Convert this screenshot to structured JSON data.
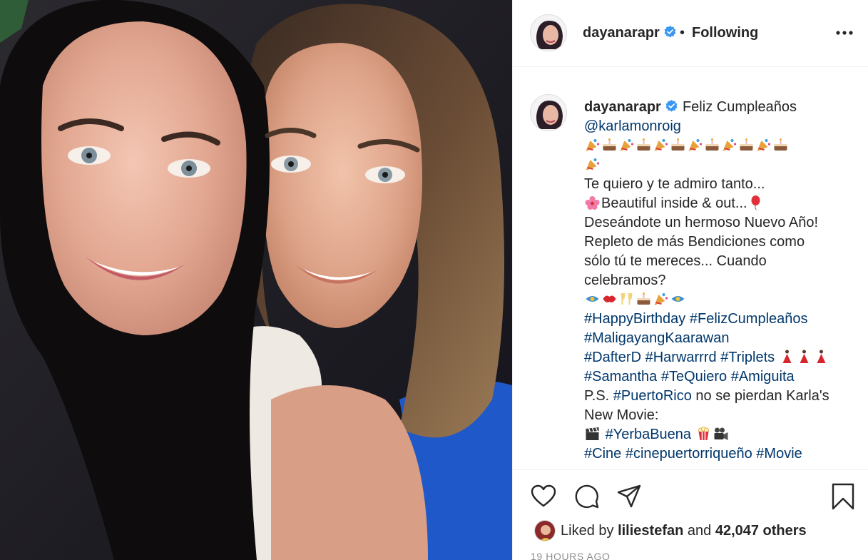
{
  "post": {
    "username": "dayanarapr",
    "dot": "•",
    "follow_status": "Following",
    "more_icon": "more-horizontal-icon",
    "verified_icon": "verified-badge-icon",
    "caption": {
      "greeting": "Feliz Cumpleaños",
      "mention": "@karlamonroig",
      "line_admire": "Te quiero y te admiro tanto...",
      "line_beautiful": "Beautiful inside & out...",
      "line_new_year": "Deseándote un hermoso Nuevo Año!",
      "line_blessings": "Repleto de más Bendiciones como",
      "line_deserve": "sólo tú te mereces... Cuando",
      "line_celebrate": "celebramos?",
      "tag_happybirthday": "#HappyBirthday",
      "tag_felizcumple": "#FelizCumpleaños",
      "tag_maligayang": "#MaligayangKaarawan",
      "tag_dafterd": "#DafterD",
      "tag_harwarrrd": "#Harwarrrd",
      "tag_triplets": "#Triplets",
      "tag_samantha": "#Samantha",
      "tag_tequiero": "#TeQuiero",
      "tag_amiguita": "#Amiguita",
      "ps_prefix": "P.S.",
      "tag_puertorico": "#PuertoRico",
      "ps_rest": "no se pierdan Karla's",
      "line_movie": "New Movie:",
      "tag_yerbabuena": "#YerbaBuena",
      "tag_cine": "#Cine",
      "tag_cinepr": "#cinepuertorriqueño",
      "tag_movie": "#Movie"
    },
    "likes": {
      "prefix": "Liked by",
      "liker": "liliestefan",
      "joiner": "and",
      "others": "42,047 others"
    },
    "timestamp": "19 HOURS AGO"
  },
  "icons": {
    "like": "heart-icon",
    "comment": "comment-icon",
    "share": "paper-plane-icon",
    "save": "bookmark-icon"
  },
  "colors": {
    "text": "#262626",
    "link": "#00376b",
    "verified": "#3897f0",
    "muted": "#8e8e8e",
    "divider": "#efefef"
  }
}
